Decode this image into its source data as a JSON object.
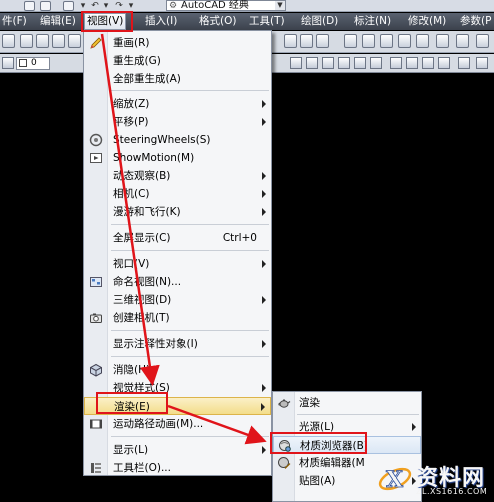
{
  "app": {
    "workspace": "AutoCAD 经典"
  },
  "menubar": {
    "items": [
      {
        "label": "件(F)"
      },
      {
        "label": "编辑(E)"
      },
      {
        "label": "视图(V)"
      },
      {
        "label": "插入(I)"
      },
      {
        "label": "格式(O)"
      },
      {
        "label": "工具(T)"
      },
      {
        "label": "绘图(D)"
      },
      {
        "label": "标注(N)"
      },
      {
        "label": "修改(M)"
      },
      {
        "label": "参数(P"
      }
    ]
  },
  "toolbar2": {
    "layer_value": "0"
  },
  "view_menu": {
    "items": [
      {
        "label": "重画(R)"
      },
      {
        "label": "重生成(G)"
      },
      {
        "label": "全部重生成(A)"
      },
      {
        "label": "缩放(Z)",
        "submenu": true
      },
      {
        "label": "平移(P)",
        "submenu": true
      },
      {
        "label": "SteeringWheels(S)",
        "icon": "steering-wheel-icon"
      },
      {
        "label": "ShowMotion(M)",
        "icon": "showmotion-icon"
      },
      {
        "label": "动态观察(B)",
        "submenu": true
      },
      {
        "label": "相机(C)",
        "submenu": true
      },
      {
        "label": "漫游和飞行(K)",
        "submenu": true
      },
      {
        "label": "全屏显示(C)",
        "shortcut": "Ctrl+0"
      },
      {
        "label": "视口(V)",
        "submenu": true
      },
      {
        "label": "命名视图(N)...",
        "icon": "named-view-icon"
      },
      {
        "label": "三维视图(D)",
        "submenu": true
      },
      {
        "label": "创建相机(T)",
        "icon": "camera-icon"
      },
      {
        "label": "显示注释性对象(I)",
        "submenu": true
      },
      {
        "label": "消隐(H)",
        "icon": "hide-icon"
      },
      {
        "label": "视觉样式(S)",
        "submenu": true
      },
      {
        "label": "渲染(E)",
        "submenu": true
      },
      {
        "label": "运动路径动画(M)...",
        "icon": "motion-path-icon"
      },
      {
        "label": "显示(L)",
        "submenu": true
      },
      {
        "label": "工具栏(O)...",
        "icon": "toolbar-icon"
      }
    ]
  },
  "render_submenu": {
    "items": [
      {
        "label": "渲染",
        "icon": "teapot-icon"
      },
      {
        "label": "光源(L)",
        "submenu": true
      },
      {
        "label": "材质浏览器(B)",
        "icon": "material-browser-icon"
      },
      {
        "label": "材质编辑器(M",
        "icon": "material-editor-icon"
      },
      {
        "label": "贴图(A)",
        "submenu": true
      }
    ]
  },
  "watermark": {
    "title": "资料网",
    "url": "ZL.XS1616.COM"
  },
  "colors": {
    "annotation_red": "#e0141a",
    "menubar_bg": "#3b414c",
    "canvas_bg": "#000000"
  }
}
